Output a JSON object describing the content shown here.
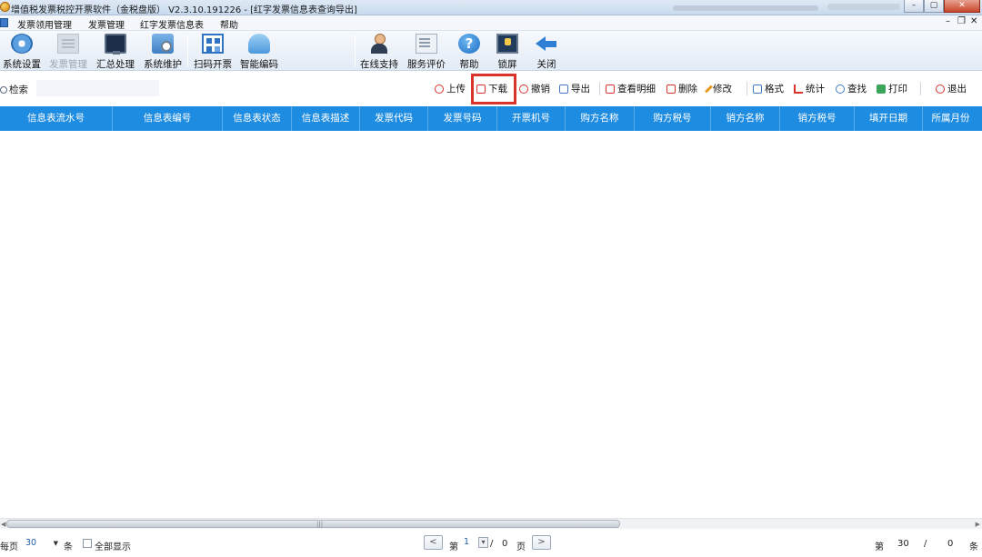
{
  "window": {
    "title": "增值税发票税控开票软件（金税盘版） V2.3.10.191226 - [红字发票信息表查询导出]",
    "controls": {
      "minimize": "–",
      "restore": "▢",
      "close": "✕"
    }
  },
  "menubar": {
    "items": [
      "发票领用管理",
      "发票管理",
      "红字发票信息表",
      "帮助"
    ],
    "mdi": {
      "minimize": "–",
      "restore": "❐",
      "close": "✕"
    }
  },
  "toolbar": {
    "items": [
      {
        "label": "系统设置",
        "icon": "gear-icon"
      },
      {
        "label": "发票管理",
        "icon": "invoice-manage-icon",
        "disabled": true
      },
      {
        "label": "汇总处理",
        "icon": "monitor-icon"
      },
      {
        "label": "系统维护",
        "icon": "maintenance-icon"
      },
      {
        "label": "扫码开票",
        "icon": "qr-code-icon"
      },
      {
        "label": "智能编码",
        "icon": "cloud-icon"
      },
      {
        "label": "在线支持",
        "icon": "support-person-icon"
      },
      {
        "label": "服务评价",
        "icon": "review-icon"
      },
      {
        "label": "帮助",
        "icon": "help-icon"
      },
      {
        "label": "锁屏",
        "icon": "lock-screen-icon"
      },
      {
        "label": "关闭",
        "icon": "back-arrow-icon"
      }
    ]
  },
  "actionbar": {
    "search_label": "检索",
    "search_value": "",
    "actions": {
      "upload": "上传",
      "download": "下载",
      "revoke": "撤销",
      "export": "导出",
      "view_detail": "查看明细",
      "delete": "删除",
      "modify": "修改",
      "format": "格式",
      "stats": "统计",
      "find": "查找",
      "print": "打印",
      "exit": "退出"
    },
    "colors": {
      "highlight": "#d9332b"
    }
  },
  "grid": {
    "columns": [
      "信息表流水号",
      "信息表编号",
      "信息表状态",
      "信息表描述",
      "发票代码",
      "发票号码",
      "开票机号",
      "购方名称",
      "购方税号",
      "销方名称",
      "销方税号",
      "填开日期",
      "所属月份"
    ],
    "rows": [],
    "header_color": "#1e8ce0"
  },
  "footer": {
    "per_page_label": "每页",
    "page_size": "30",
    "unit": "条",
    "show_all": "全部显示",
    "prev": "<",
    "page_prefix": "第",
    "current_page": "1",
    "slash": "/",
    "total_pages": "0",
    "page_suffix": "页",
    "next": ">",
    "right_prefix": "第",
    "right_value": "30",
    "right_slash": "/",
    "right_total": "0",
    "right_unit": "条"
  }
}
